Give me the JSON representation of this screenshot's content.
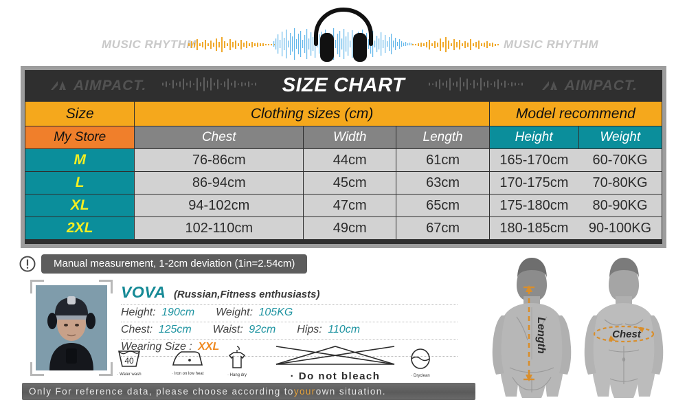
{
  "banner": {
    "brand_left": "MUSIC RHYTHM",
    "brand_right": "MUSIC RHYTHM",
    "headphones_icon": "headphones-icon",
    "waveform_icon": "audio-waveform-icon"
  },
  "chart": {
    "title": "SIZE CHART",
    "logo_left": "AIMPACT.",
    "logo_right": "AIMPACT.",
    "table": {
      "group_headers": [
        "Size",
        "Clothing sizes  (cm)",
        "Model recommend"
      ],
      "sub_headers": [
        "My Store",
        "Chest",
        "Width",
        "Length",
        "Height",
        "Weight"
      ],
      "rows": [
        {
          "size": "M",
          "chest": "76-86cm",
          "width": "44cm",
          "length": "61cm",
          "height": "165-170cm",
          "weight": "60-70KG"
        },
        {
          "size": "L",
          "chest": "86-94cm",
          "width": "45cm",
          "length": "63cm",
          "height": "170-175cm",
          "weight": "70-80KG"
        },
        {
          "size": "XL",
          "chest": "94-102cm",
          "width": "47cm",
          "length": "65cm",
          "height": "175-180cm",
          "weight": "80-90KG"
        },
        {
          "size": "2XL",
          "chest": "102-110cm",
          "width": "49cm",
          "length": "67cm",
          "height": "180-185cm",
          "weight": "90-100KG"
        }
      ]
    }
  },
  "notice": {
    "icon": "exclamation-circle-icon",
    "text": "Manual measurement, 1-2cm deviation (1in=2.54cm)"
  },
  "model": {
    "photo_alt": "model-portrait",
    "name": "VOVA",
    "description": "(Russian,Fitness enthusiasts)",
    "height_label": "Height:",
    "height_value": "190cm",
    "weight_label": "Weight:",
    "weight_value": "105KG",
    "chest_label": "Chest:",
    "chest_value": "125cm",
    "waist_label": "Waist:",
    "waist_value": "92cm",
    "hips_label": "Hips:",
    "hips_value": "110cm",
    "wearing_size_label": "Wearing Size :",
    "wearing_size_value": "XXL"
  },
  "care": [
    {
      "icon": "water-wash-icon",
      "label": "· Water wash",
      "value": "40"
    },
    {
      "icon": "iron-low-heat-icon",
      "label": "· Iron on low heat",
      "value": ""
    },
    {
      "icon": "hang-dry-icon",
      "label": "· Hang dry",
      "value": ""
    },
    {
      "icon": "do-not-bleach-icon",
      "label": "· Do not bleach",
      "value": ""
    },
    {
      "icon": "dry-clean-icon",
      "label": "· Dryclean",
      "value": ""
    }
  ],
  "disclaimer": {
    "part1": "Only For reference data, please choose according to ",
    "highlight": "your",
    "part2": " own situation."
  },
  "bodies": {
    "length_label": "Length",
    "chest_label": "Chest",
    "back_view": "body-back-silhouette",
    "front_view": "body-front-silhouette"
  },
  "colors": {
    "orange_header": "#f5a81c",
    "orange_mystore": "#f07f2b",
    "teal": "#0b8e9b",
    "gray_sub": "#848484",
    "data_gray": "#d2d2d2",
    "dark": "#2f2f2f",
    "frame_gray": "#9d9d9d",
    "yellow_text": "#f4ee22",
    "accent_orange": "#ef8a22"
  }
}
